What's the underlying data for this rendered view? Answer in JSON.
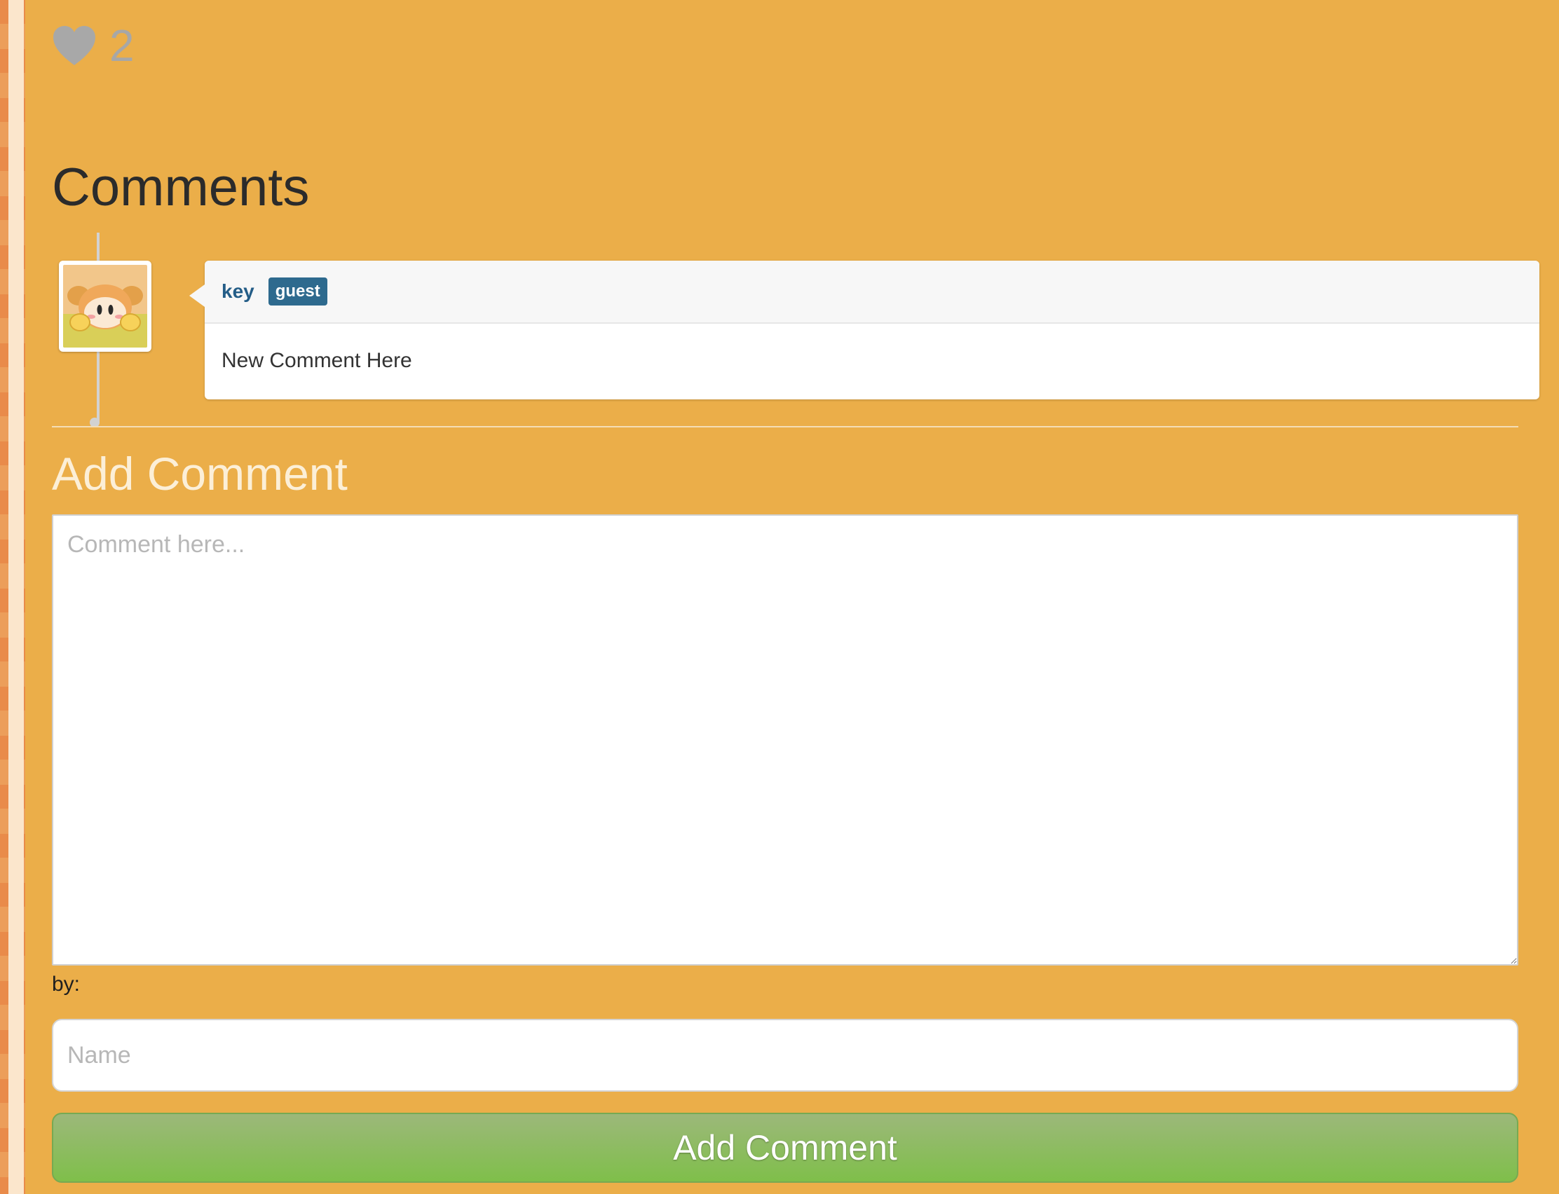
{
  "likes": {
    "icon": "heart-icon",
    "count": "2"
  },
  "comments_section": {
    "title": "Comments",
    "comments": [
      {
        "author": "key",
        "badge": "guest",
        "text": "New Comment Here",
        "avatar": "character-avatar"
      }
    ]
  },
  "add_comment": {
    "title": "Add Comment",
    "textarea_placeholder": "Comment here...",
    "by_label": "by:",
    "name_placeholder": "Name",
    "submit_label": "Add Comment"
  },
  "colors": {
    "page_background": "#EBAE49",
    "author_link": "#245D87",
    "badge_background": "#2E6A8E",
    "submit_button": "#7FBF4A"
  }
}
